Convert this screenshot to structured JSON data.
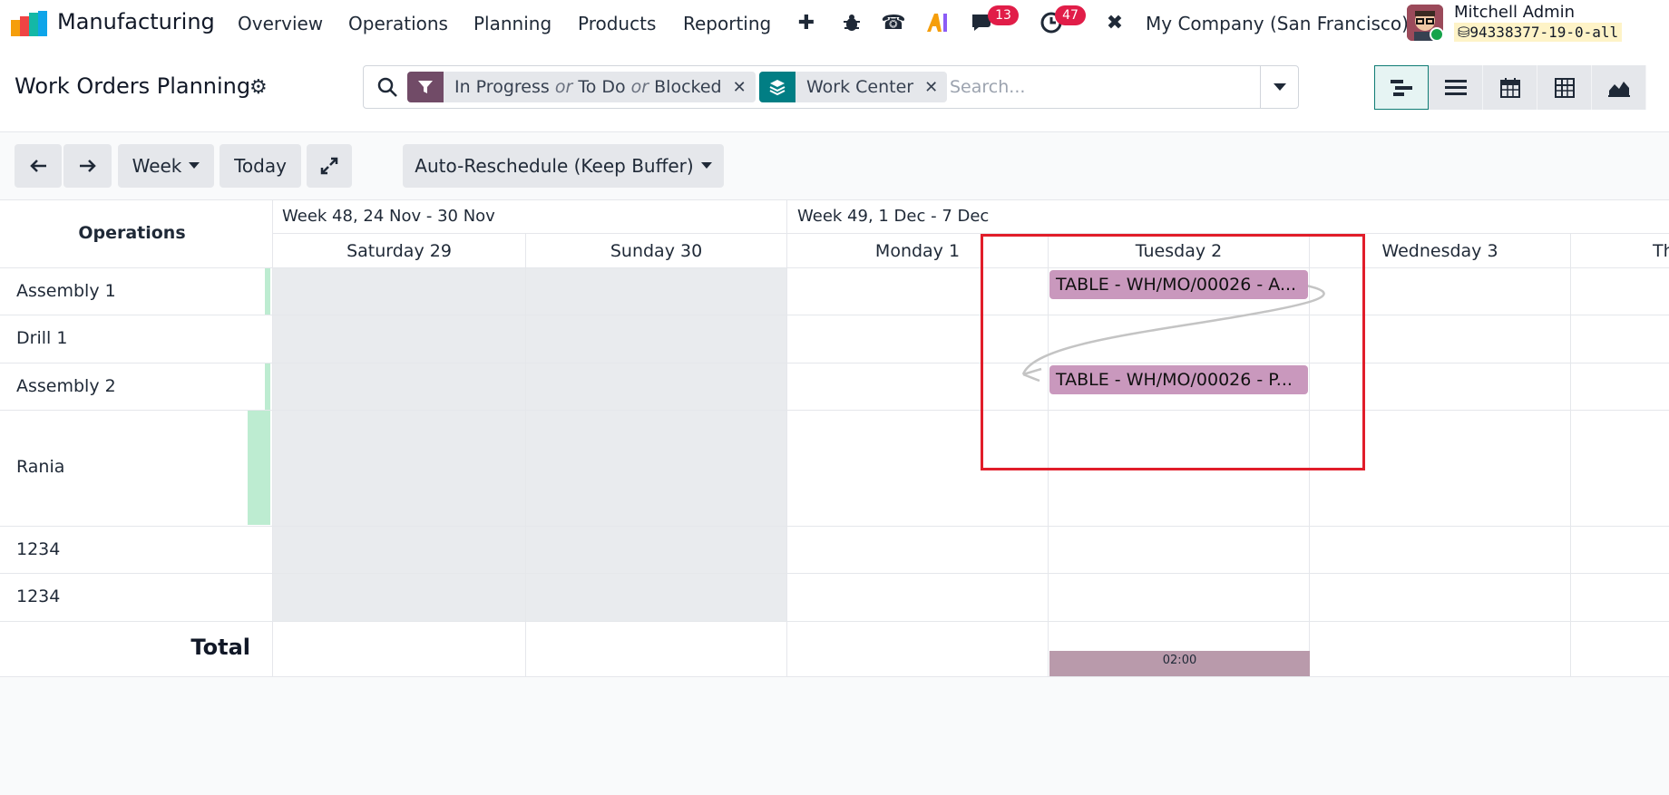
{
  "navbar": {
    "app_name": "Manufacturing",
    "menu": [
      "Overview",
      "Operations",
      "Planning",
      "Products",
      "Reporting"
    ],
    "messages_count": "13",
    "activities_count": "47",
    "company": "My Company (San Francisco)",
    "user_name": "Mitchell Admin",
    "database": "94338377-19-0-all"
  },
  "control": {
    "title": "Work Orders Planning",
    "filters": {
      "status_a": "In Progress",
      "or1": "or",
      "status_b": "To Do",
      "or2": "or",
      "status_c": "Blocked",
      "groupby": "Work Center"
    },
    "search_placeholder": "Search...",
    "scale": "Week",
    "today": "Today",
    "reschedule": "Auto-Reschedule (Keep Buffer)"
  },
  "gantt": {
    "rows_header": "Operations",
    "weeks": [
      "Week 48, 24 Nov - 30 Nov",
      "Week 49, 1 Dec - 7 Dec"
    ],
    "days": [
      "Saturday 29",
      "Sunday 30",
      "Monday 1",
      "Tuesday 2",
      "Wednesday 3",
      "Th"
    ],
    "rows": [
      "Assembly 1",
      "Drill 1",
      "Assembly 2",
      "Rania",
      "1234",
      "1234"
    ],
    "pills": [
      "TABLE - WH/MO/00026 - A...",
      "TABLE - WH/MO/00026 - P..."
    ],
    "total_label": "Total",
    "total_value": "02:00"
  },
  "colors": {
    "accent": "#714B67",
    "teal": "#017E84",
    "pill": "#C998BD",
    "highlight": "#E11D2A"
  }
}
